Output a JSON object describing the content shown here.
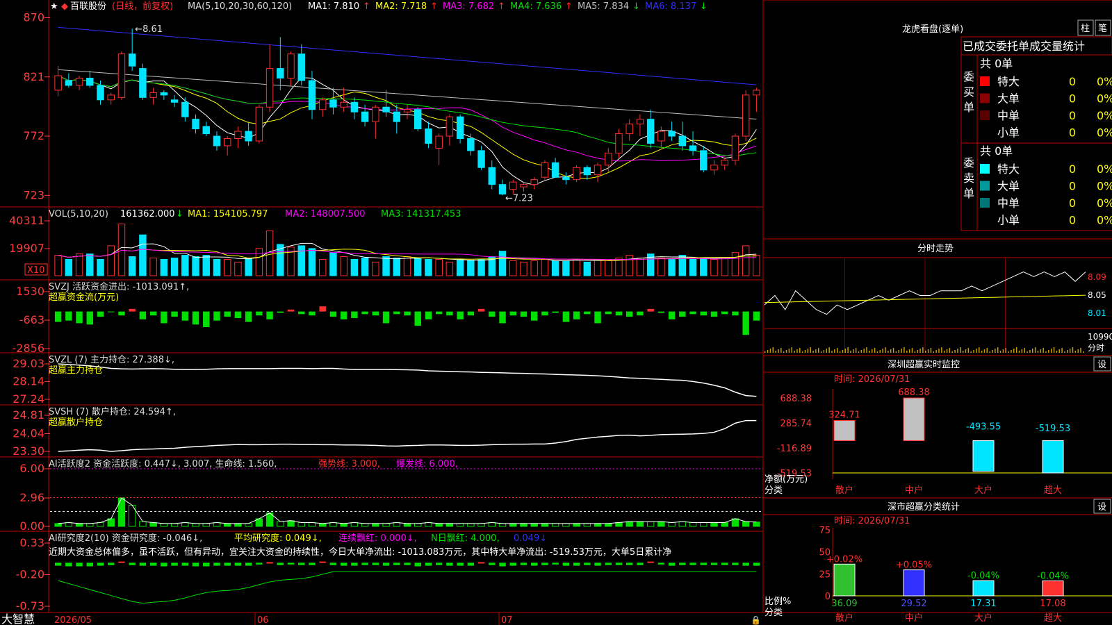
{
  "colors": {
    "up": "#ff3030",
    "down": "#00e5ff",
    "green": "#00e000",
    "grid": "#b40000",
    "axis": "#ff3b3b",
    "yellow": "#ffff00",
    "magenta": "#ff00ff",
    "white": "#ffffff",
    "blue": "#3030ff",
    "gray": "#c0c0c0"
  },
  "main_panel": {
    "star": "★",
    "stock_name": "百联股份",
    "mode": "(日线，前复权)",
    "ma_header": "MA(5,10,20,30,60,120)",
    "ma_items": [
      {
        "label": "MA1: 7.810",
        "arrow": "↑",
        "color": "#ffffff"
      },
      {
        "label": "MA2: 7.718",
        "arrow": "↑",
        "color": "#ffff00"
      },
      {
        "label": "MA3: 7.682",
        "arrow": "↑",
        "color": "#ff00ff"
      },
      {
        "label": "MA4: 7.636",
        "arrow": "↑",
        "color": "#00e000"
      },
      {
        "label": "MA5: 7.834",
        "arrow": "↓",
        "color": "#c0c0c0"
      },
      {
        "label": "MA6: 8.137",
        "arrow": "↓",
        "color": "#3030ff"
      }
    ],
    "y_ticks": [
      "870",
      "821",
      "772",
      "723"
    ],
    "high_mark": "8.61",
    "low_mark": "7.23"
  },
  "vol_panel": {
    "header": "VOL(5,10,20)",
    "value": "161362.000",
    "arrow": "↓",
    "ma1": "MA1: 154105.797",
    "ma2": "MA2: 148007.500",
    "ma3": "MA3: 141317.453",
    "y_ticks": [
      "40311",
      "19907"
    ],
    "unit": "X10"
  },
  "svzj_panel": {
    "line1": "SVZJ  活跃资金进出: -1013.091↑,",
    "line2": "超赢资金流(万元)",
    "y_ticks": [
      "1530",
      "-663",
      "-2856"
    ]
  },
  "svzl_panel": {
    "line1": "SVZL (7) 主力持仓: 27.388↓,",
    "line2": "超赢主力持仓",
    "y_ticks": [
      "29.03",
      "28.14",
      "27.24"
    ]
  },
  "svsh_panel": {
    "line1": "SVSH (7) 散户持仓: 24.594↑,",
    "line2": "超赢散户持仓",
    "y_ticks": [
      "24.81",
      "24.04",
      "23.30"
    ]
  },
  "ai_active_panel": {
    "prefix": "AI活跃度2 资金活跃度: 0.447↓, 3.007, 生命线: 1.560,",
    "strong": "强势线: 3.000,",
    "burst": "爆发线: 6.000,",
    "y_ticks": [
      "6.00",
      "2.96",
      "0.00"
    ]
  },
  "ai_research_panel": {
    "prefix": "AI研究度2(10) 资金研究度: -0.046↓,",
    "avg": "平均研究度: 0.049↓,",
    "streak": "连续飘红: 0.000↓,",
    "nday": "N日飘红: 4.000,",
    "last": "0.049↓",
    "note": "近期大资金总体偏多，虽不活跃，但有异动，宜关注大资金的持续性，今日大单净流出: -1013.083万元，其中特大单净流出: -519.53万元，大单5日累计净",
    "y_ticks": [
      "0.33",
      "-0.20",
      "-0.73"
    ]
  },
  "x_axis": {
    "labels": [
      "2026/05",
      "06",
      "07"
    ]
  },
  "brand": "大智慧",
  "longhu": {
    "title": "龙虎看盘(逐单)",
    "btn_zhu": "柱",
    "btn_bi": "笔",
    "tabs": "已成交委托单成交量统计",
    "buy_label": "委买单",
    "sell_label": "委卖单",
    "buy_total": "共 0单",
    "sell_total": "共 0单",
    "rows_buy": [
      {
        "name": "特大",
        "count": "0",
        "pct": "0%",
        "color": "#ff0000"
      },
      {
        "name": "大单",
        "count": "0",
        "pct": "0%",
        "color": "#8b0000"
      },
      {
        "name": "中单",
        "count": "0",
        "pct": "0%",
        "color": "#5a0000"
      },
      {
        "name": "小单",
        "count": "0",
        "pct": "0%",
        "color": "#000000"
      }
    ],
    "rows_sell": [
      {
        "name": "特大",
        "count": "0",
        "pct": "0%",
        "color": "#00ffff"
      },
      {
        "name": "大单",
        "count": "0",
        "pct": "0%",
        "color": "#009a9a"
      },
      {
        "name": "中单",
        "count": "0",
        "pct": "0%",
        "color": "#007777"
      },
      {
        "name": "小单",
        "count": "0",
        "pct": "0%",
        "color": "#000000"
      }
    ]
  },
  "intraday": {
    "title": "分时走势",
    "y_ticks": [
      "8.09",
      "8.05",
      "8.01"
    ],
    "vol_label": "10990",
    "unit": "分时"
  },
  "monitor": {
    "title": "深圳超赢实时监控",
    "btn": "设",
    "time": "时间: 2026/07/31",
    "y_ticks": [
      "688.38",
      "285.74",
      "-116.89",
      "-519.53"
    ],
    "y_unit": "净额(万元)",
    "x_label": "分类"
  },
  "classify": {
    "title": "深市超赢分类统计",
    "btn": "设",
    "time": "时间: 2026/07/31",
    "y_ticks": [
      "75",
      "50",
      "25",
      "0"
    ],
    "y_unit": "比例%",
    "x_label": "分类"
  },
  "chart_data": [
    {
      "type": "candlestick",
      "title": "百联股份 (日线，前复权)",
      "x_labels": [
        "2026/05",
        "06",
        "07"
      ],
      "ylim": [
        7.18,
        8.72
      ],
      "ohlc": [
        [
          8.1,
          8.3,
          8.05,
          8.22
        ],
        [
          8.18,
          8.24,
          8.12,
          8.14
        ],
        [
          8.14,
          8.22,
          8.1,
          8.2
        ],
        [
          8.2,
          8.26,
          8.12,
          8.14
        ],
        [
          8.14,
          8.18,
          7.98,
          8.02
        ],
        [
          8.02,
          8.08,
          7.98,
          8.06
        ],
        [
          8.04,
          8.42,
          8.02,
          8.4
        ],
        [
          8.4,
          8.61,
          8.26,
          8.3
        ],
        [
          8.28,
          8.32,
          8.02,
          8.04
        ],
        [
          8.04,
          8.12,
          7.98,
          8.08
        ],
        [
          8.08,
          8.1,
          8.02,
          8.06
        ],
        [
          8.02,
          8.06,
          7.96,
          8.0
        ],
        [
          8.0,
          8.04,
          7.84,
          7.88
        ],
        [
          7.86,
          7.9,
          7.74,
          7.78
        ],
        [
          7.8,
          7.84,
          7.72,
          7.74
        ],
        [
          7.72,
          7.76,
          7.6,
          7.64
        ],
        [
          7.64,
          7.72,
          7.56,
          7.7
        ],
        [
          7.7,
          7.8,
          7.62,
          7.76
        ],
        [
          7.76,
          7.84,
          7.64,
          7.68
        ],
        [
          7.68,
          7.98,
          7.66,
          7.96
        ],
        [
          7.96,
          8.48,
          7.92,
          8.28
        ],
        [
          8.28,
          8.54,
          8.1,
          8.2
        ],
        [
          8.2,
          8.42,
          8.14,
          8.4
        ],
        [
          8.4,
          8.48,
          8.14,
          8.18
        ],
        [
          8.18,
          8.26,
          7.86,
          7.94
        ],
        [
          7.94,
          8.04,
          7.88,
          8.02
        ],
        [
          8.02,
          8.12,
          7.9,
          7.96
        ],
        [
          7.96,
          8.12,
          7.92,
          8.0
        ],
        [
          8.0,
          8.04,
          7.86,
          7.92
        ],
        [
          7.92,
          7.98,
          7.8,
          7.84
        ],
        [
          7.84,
          7.98,
          7.7,
          7.96
        ],
        [
          7.96,
          8.1,
          7.88,
          7.92
        ],
        [
          7.92,
          7.98,
          7.74,
          7.84
        ],
        [
          7.92,
          7.98,
          7.86,
          7.94
        ],
        [
          7.94,
          7.96,
          7.76,
          7.78
        ],
        [
          7.78,
          7.84,
          7.62,
          7.66
        ],
        [
          7.62,
          7.74,
          7.48,
          7.72
        ],
        [
          7.72,
          7.9,
          7.64,
          7.88
        ],
        [
          7.88,
          7.9,
          7.66,
          7.7
        ],
        [
          7.7,
          7.74,
          7.56,
          7.6
        ],
        [
          7.6,
          7.64,
          7.44,
          7.46
        ],
        [
          7.46,
          7.52,
          7.28,
          7.32
        ],
        [
          7.32,
          7.36,
          7.23,
          7.24
        ],
        [
          7.28,
          7.36,
          7.24,
          7.34
        ],
        [
          7.3,
          7.34,
          7.26,
          7.32
        ],
        [
          7.32,
          7.38,
          7.28,
          7.36
        ],
        [
          7.38,
          7.52,
          7.36,
          7.5
        ],
        [
          7.5,
          7.54,
          7.38,
          7.38
        ],
        [
          7.38,
          7.42,
          7.32,
          7.36
        ],
        [
          7.36,
          7.48,
          7.34,
          7.46
        ],
        [
          7.46,
          7.48,
          7.36,
          7.4
        ],
        [
          7.4,
          7.5,
          7.34,
          7.48
        ],
        [
          7.48,
          7.62,
          7.42,
          7.58
        ],
        [
          7.58,
          7.78,
          7.54,
          7.74
        ],
        [
          7.74,
          7.86,
          7.68,
          7.82
        ],
        [
          7.82,
          7.9,
          7.72,
          7.86
        ],
        [
          7.86,
          7.94,
          7.62,
          7.66
        ],
        [
          7.68,
          7.8,
          7.62,
          7.76
        ],
        [
          7.76,
          7.84,
          7.68,
          7.72
        ],
        [
          7.72,
          7.84,
          7.6,
          7.64
        ],
        [
          7.64,
          7.76,
          7.56,
          7.6
        ],
        [
          7.6,
          7.64,
          7.42,
          7.44
        ],
        [
          7.44,
          7.52,
          7.4,
          7.48
        ],
        [
          7.48,
          7.54,
          7.44,
          7.52
        ],
        [
          7.52,
          7.74,
          7.48,
          7.72
        ],
        [
          7.72,
          8.1,
          7.68,
          8.06
        ],
        [
          8.06,
          8.12,
          7.92,
          8.1
        ]
      ],
      "series": [
        {
          "name": "MA1",
          "color": "#ffffff"
        },
        {
          "name": "MA2",
          "color": "#ffff00"
        },
        {
          "name": "MA3",
          "color": "#ff00ff"
        },
        {
          "name": "MA4",
          "color": "#00e000"
        },
        {
          "name": "MA5",
          "color": "#c0c0c0"
        },
        {
          "name": "MA6",
          "color": "#3030ff"
        }
      ]
    },
    {
      "type": "bar",
      "title": "VOL(5,10,20)",
      "ylim": [
        0,
        40311
      ],
      "values": [
        15000,
        12000,
        16000,
        16000,
        12000,
        22000,
        38000,
        14000,
        30000,
        13000,
        12000,
        13000,
        15000,
        14000,
        15000,
        12000,
        12000,
        10000,
        13000,
        20000,
        33000,
        23000,
        21000,
        22000,
        20000,
        12000,
        17000,
        14000,
        12000,
        13000,
        10000,
        14000,
        13000,
        14000,
        13000,
        12000,
        12000,
        10000,
        12000,
        11000,
        12000,
        14000,
        18000,
        11000,
        10000,
        11000,
        12000,
        11000,
        11000,
        12000,
        10000,
        12000,
        11000,
        13000,
        15000,
        13000,
        16000,
        13000,
        12000,
        15000,
        12000,
        13000,
        12000,
        13000,
        17000,
        22000,
        15000
      ]
    },
    {
      "type": "bar",
      "title": "SVZJ 活跃资金进出",
      "ylim": [
        -2856,
        1530
      ],
      "values": [
        -800,
        -700,
        -900,
        -1000,
        -400,
        -50,
        -300,
        200,
        -600,
        -300,
        -900,
        -400,
        -700,
        -1000,
        -1200,
        -700,
        -400,
        -500,
        -800,
        -300,
        -600,
        -100,
        150,
        -200,
        -300,
        400,
        -400,
        -600,
        -500,
        -200,
        -300,
        -900,
        -200,
        -300,
        -1100,
        -600,
        -200,
        -300,
        -600,
        -300,
        200,
        -400,
        -900,
        -300,
        -400,
        -700,
        -300,
        -100,
        -800,
        -600,
        -200,
        -900,
        -200,
        -300,
        -400,
        -300,
        200,
        -100,
        -600,
        -400,
        -200,
        -300,
        -400,
        -200,
        -300,
        -1800,
        -700
      ]
    },
    {
      "type": "line",
      "title": "SVZL 主力持仓",
      "ylim": [
        27.24,
        29.03
      ],
      "values": [
        29.03,
        29.0,
        28.97,
        28.93,
        28.87,
        28.8,
        28.78,
        28.77,
        28.78,
        28.79,
        28.78,
        28.76,
        28.75,
        28.75,
        28.76,
        28.78,
        28.79,
        28.79,
        28.79,
        28.79,
        28.79,
        28.8,
        28.8,
        28.8,
        28.79,
        28.8,
        28.8,
        28.77,
        28.75,
        28.75,
        28.75,
        28.75,
        28.74,
        28.73,
        28.72,
        28.68,
        28.66,
        28.65,
        28.63,
        28.62,
        28.6,
        28.59,
        28.58,
        28.56,
        28.55,
        28.53,
        28.52,
        28.5,
        28.48,
        28.47,
        28.45,
        28.43,
        28.4,
        28.36,
        28.32,
        28.3,
        28.27,
        28.25,
        28.22,
        28.2,
        28.14,
        28.06,
        27.95,
        27.82,
        27.6,
        27.43,
        27.39
      ]
    },
    {
      "type": "line",
      "title": "SVSH 散户持仓",
      "ylim": [
        23.3,
        24.81
      ],
      "values": [
        23.3,
        23.32,
        23.35,
        23.37,
        23.35,
        23.3,
        23.33,
        23.37,
        23.39,
        23.4,
        23.42,
        23.43,
        23.47,
        23.5,
        23.52,
        23.55,
        23.57,
        23.59,
        23.58,
        23.58,
        23.59,
        23.6,
        23.6,
        23.59,
        23.59,
        23.58,
        23.58,
        23.57,
        23.57,
        23.56,
        23.55,
        23.53,
        23.52,
        23.54,
        23.55,
        23.57,
        23.57,
        23.56,
        23.55,
        23.55,
        23.56,
        23.58,
        23.59,
        23.6,
        23.6,
        23.61,
        23.61,
        23.65,
        23.71,
        23.8,
        23.85,
        23.9,
        23.93,
        23.97,
        23.98,
        23.95,
        23.97,
        24.0,
        24.01,
        24.02,
        24.03,
        24.05,
        24.1,
        24.25,
        24.48,
        24.59,
        24.59
      ]
    },
    {
      "type": "bar",
      "title": "AI活跃度2 资金活跃度",
      "ylim": [
        0,
        6.0
      ],
      "values": [
        0.3,
        0.4,
        0.3,
        0.3,
        0.4,
        0.8,
        2.96,
        2.2,
        0.5,
        0.4,
        0.3,
        0.3,
        0.4,
        0.3,
        0.3,
        0.4,
        0.3,
        0.3,
        0.3,
        0.8,
        1.4,
        0.5,
        0.6,
        0.4,
        0.4,
        0.3,
        0.4,
        0.3,
        0.4,
        0.3,
        0.3,
        0.3,
        0.4,
        0.3,
        0.3,
        0.4,
        0.3,
        0.3,
        0.3,
        0.3,
        0.3,
        0.4,
        0.3,
        0.3,
        0.3,
        0.3,
        0.3,
        0.3,
        0.3,
        0.3,
        0.3,
        0.3,
        0.3,
        0.4,
        0.5,
        0.5,
        0.5,
        0.5,
        0.4,
        0.5,
        0.4,
        0.4,
        0.4,
        0.4,
        0.8,
        0.5,
        0.45
      ]
    },
    {
      "type": "bar",
      "title": "AI研究度2(10) 资金研究度",
      "ylim": [
        -0.73,
        0.33
      ],
      "values": [
        -0.05,
        -0.06,
        -0.06,
        -0.06,
        -0.05,
        -0.04,
        0.02,
        -0.04,
        -0.05,
        -0.05,
        -0.06,
        -0.05,
        -0.05,
        -0.06,
        -0.06,
        -0.05,
        -0.05,
        -0.05,
        -0.05,
        -0.03,
        0.01,
        -0.04,
        -0.03,
        -0.04,
        -0.04,
        0.02,
        -0.04,
        -0.05,
        -0.05,
        -0.04,
        -0.04,
        -0.05,
        -0.04,
        -0.04,
        -0.06,
        -0.05,
        -0.04,
        -0.05,
        -0.05,
        -0.05,
        0.01,
        -0.04,
        -0.06,
        -0.05,
        -0.04,
        -0.05,
        -0.04,
        -0.03,
        -0.05,
        -0.05,
        -0.04,
        -0.05,
        -0.04,
        -0.04,
        -0.04,
        -0.04,
        0.02,
        -0.03,
        -0.05,
        -0.04,
        -0.04,
        -0.04,
        -0.04,
        -0.04,
        -0.04,
        -0.05,
        -0.05
      ]
    },
    {
      "type": "line",
      "title": "分时走势",
      "ylim": [
        7.98,
        8.12
      ],
      "values": [
        8.03,
        8.05,
        8.02,
        8.06,
        8.04,
        8.02,
        8.01,
        8.03,
        8.02,
        8.03,
        8.04,
        8.05,
        8.04,
        8.05,
        8.06,
        8.05,
        8.05,
        8.06,
        8.06,
        8.06,
        8.07,
        8.06,
        8.07,
        8.08,
        8.09,
        8.1,
        8.09,
        8.1,
        8.09,
        8.1,
        8.08,
        8.1
      ]
    },
    {
      "type": "bar",
      "title": "深圳超赢实时监控",
      "categories": [
        "散户",
        "中户",
        "大户",
        "超大"
      ],
      "values": [
        324.71,
        688.38,
        -493.55,
        -519.53
      ],
      "ylim": [
        -519.53,
        688.38
      ],
      "ylabel": "净额(万元)",
      "xlabel": "分类"
    },
    {
      "type": "bar",
      "title": "深市超赢分类统计",
      "categories": [
        "散户",
        "中户",
        "大户",
        "超大"
      ],
      "values": [
        36.09,
        29.52,
        17.31,
        17.08
      ],
      "changes": [
        "+0.02%",
        "+0.05%",
        "-0.04%",
        "-0.04%"
      ],
      "ylim": [
        0,
        75
      ],
      "ylabel": "比例%",
      "xlabel": "分类"
    }
  ]
}
